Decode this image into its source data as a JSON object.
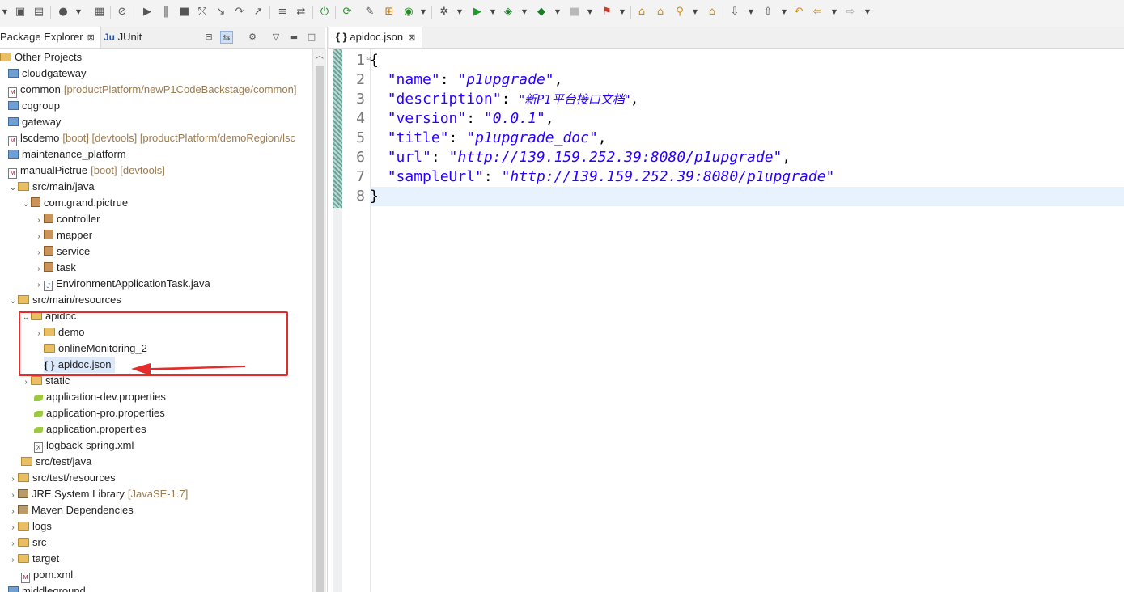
{
  "left_panel": {
    "tabs": [
      {
        "label": "Package Explorer",
        "close": "⊠"
      },
      {
        "label": "JUnit",
        "prefix": "Ju"
      }
    ],
    "tree": [
      {
        "label": "Other Projects",
        "deco": "",
        "icon": "group"
      },
      {
        "label": "cloudgateway",
        "deco": "",
        "icon": "proj"
      },
      {
        "label": "common",
        "deco": "[productPlatform/newP1CodeBackstage/common]",
        "icon": "maven"
      },
      {
        "label": "cqgroup",
        "deco": "",
        "icon": "proj"
      },
      {
        "label": "gateway",
        "deco": "",
        "icon": "proj"
      },
      {
        "label": "lscdemo",
        "deco": "[boot] [devtools] [productPlatform/demoRegion/lsc",
        "icon": "maven"
      },
      {
        "label": "maintenance_platform",
        "deco": "",
        "icon": "proj"
      },
      {
        "label": "manualPictrue",
        "deco": "[boot] [devtools]",
        "icon": "maven"
      },
      {
        "label": "src/main/java",
        "deco": "",
        "icon": "src"
      },
      {
        "label": "com.grand.pictrue",
        "deco": "",
        "icon": "pkg"
      },
      {
        "label": "controller",
        "deco": "",
        "icon": "pkg"
      },
      {
        "label": "mapper",
        "deco": "",
        "icon": "pkg"
      },
      {
        "label": "service",
        "deco": "",
        "icon": "pkg"
      },
      {
        "label": "task",
        "deco": "",
        "icon": "pkg"
      },
      {
        "label": "EnvironmentApplicationTask.java",
        "deco": "",
        "icon": "java"
      },
      {
        "label": "src/main/resources",
        "deco": "",
        "icon": "src"
      },
      {
        "label": "apidoc",
        "deco": "",
        "icon": "folder"
      },
      {
        "label": "demo",
        "deco": "",
        "icon": "folder"
      },
      {
        "label": "onlineMonitoring_2",
        "deco": "",
        "icon": "folder"
      },
      {
        "label": "apidoc.json",
        "deco": "",
        "icon": "json"
      },
      {
        "label": "static",
        "deco": "",
        "icon": "folder"
      },
      {
        "label": "application-dev.properties",
        "deco": "",
        "icon": "prop"
      },
      {
        "label": "application-pro.properties",
        "deco": "",
        "icon": "prop"
      },
      {
        "label": "application.properties",
        "deco": "",
        "icon": "prop"
      },
      {
        "label": "logback-spring.xml",
        "deco": "",
        "icon": "xml"
      },
      {
        "label": "src/test/java",
        "deco": "",
        "icon": "src"
      },
      {
        "label": "src/test/resources",
        "deco": "",
        "icon": "src"
      },
      {
        "label": "JRE System Library",
        "deco": "[JavaSE-1.7]",
        "icon": "lib"
      },
      {
        "label": "Maven Dependencies",
        "deco": "",
        "icon": "lib"
      },
      {
        "label": "logs",
        "deco": "",
        "icon": "folder"
      },
      {
        "label": "src",
        "deco": "",
        "icon": "folder"
      },
      {
        "label": "target",
        "deco": "",
        "icon": "folder"
      },
      {
        "label": "pom.xml",
        "deco": "",
        "icon": "maven"
      },
      {
        "label": "middleground",
        "deco": "",
        "icon": "proj"
      }
    ]
  },
  "editor": {
    "tab_label": "apidoc.json",
    "line_numbers": [
      "1",
      "2",
      "3",
      "4",
      "5",
      "6",
      "7",
      "8"
    ],
    "code": {
      "open": "{",
      "close": "}",
      "name_key": "\"name\"",
      "name_val": "\"p1upgrade\"",
      "desc_key": "\"description\"",
      "desc_val": "\"新P1平台接口文档\"",
      "version_key": "\"version\"",
      "version_val": "\"0.0.1\"",
      "title_key": "\"title\"",
      "title_val": "\"p1upgrade_doc\"",
      "url_key": "\"url\"",
      "url_val": "\"http://139.159.252.39:8080/p1upgrade\"",
      "sample_key": "\"sampleUrl\"",
      "sample_val": "\"http://139.159.252.39:8080/p1upgrade\""
    }
  },
  "colors": {
    "highlight_box": "#e62b2b",
    "json_string": "#2a00ff",
    "selection": "#dbe9fb"
  }
}
